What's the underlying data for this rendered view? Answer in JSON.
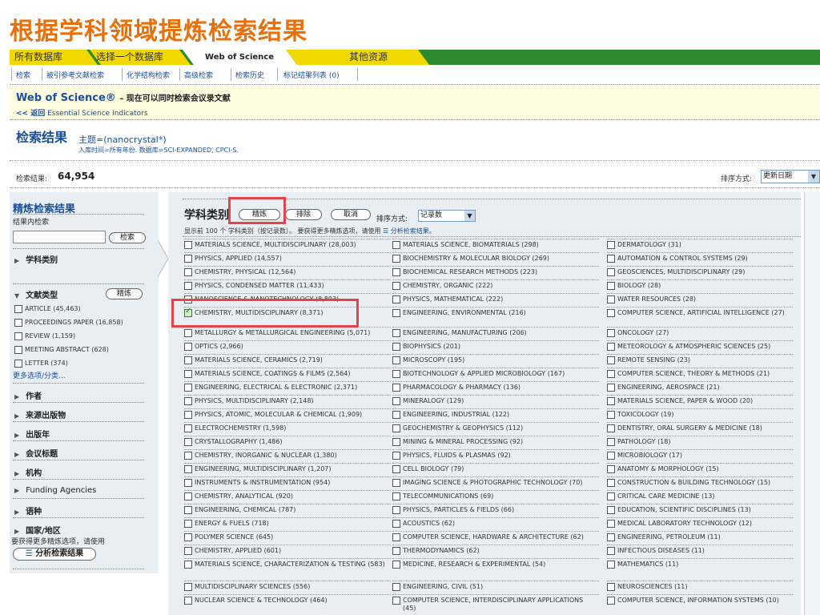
{
  "slide_title": "根据学科领域提炼检索结果",
  "tabs": {
    "all_db": "所有数据库",
    "choose_db": "选择一个数据库",
    "wos": "Web of Science",
    "other": "其他资源"
  },
  "subnav": [
    "检索",
    "被引参考文献检索",
    "化学结构检索",
    "高级检索",
    "检索历史",
    "标记结果列表 (0)"
  ],
  "wos_header": {
    "title": "Web of Science®",
    "subtitle": "– 现在可以同时检索会议录文献",
    "back": "<< 返回",
    "esi": "Essential Science Indicators"
  },
  "results": {
    "title": "检索结果",
    "topic": "主题=(nanocrystal*)",
    "meta": "入库时间=所有年份. 数据库=SCI-EXPANDED, CPCI-S.",
    "count_label": "检索结果:",
    "count": "64,954",
    "sort_label": "排序方式:",
    "sort_value": "更新日期"
  },
  "left_panel": {
    "title": "精炼检索结果",
    "hint": "结果内检索",
    "search_button": "检索",
    "subject": "学科类别",
    "doctype": "文献类型",
    "refine_button": "精炼",
    "doctypes": [
      "ARTICLE (45,463)",
      "PROCEEDINGS PAPER (16,858)",
      "REVIEW (1,159)",
      "MEETING ABSTRACT (628)",
      "LETTER (374)"
    ],
    "more": "更多选项/分类...",
    "sections": [
      "作者",
      "来源出版物",
      "出版年",
      "会议标题",
      "机构",
      "Funding Agencies",
      "语种",
      "国家/地区"
    ],
    "analyze_hint": "要获得更多精炼选项，请使用",
    "analyze_button": "分析检索结果"
  },
  "main_panel": {
    "title": "学科类别",
    "refine_button": "精炼",
    "exclude_button": "排除",
    "cancel_button": "取消",
    "sort_label": "排序方式:",
    "sort_value": "记录数",
    "showing_prefix": "显示前  100 个  学科类别（按记录数）。  要获得更多精炼选项，请使用",
    "showing_link": "分析检索结果。"
  },
  "categories": {
    "col1": [
      "MATERIALS SCIENCE, MULTIDISCIPLINARY (28,003)",
      "PHYSICS, APPLIED (14,557)",
      "CHEMISTRY, PHYSICAL (12,564)",
      "PHYSICS, CONDENSED MATTER (11,433)",
      "NANOSCIENCE & NANOTECHNOLOGY (8,893)",
      "CHEMISTRY, MULTIDISCIPLINARY (8,371)",
      "METALLURGY & METALLURGICAL ENGINEERING (5,071)",
      "OPTICS (2,966)",
      "MATERIALS SCIENCE, CERAMICS (2,719)",
      "MATERIALS SCIENCE, COATINGS & FILMS (2,564)",
      "ENGINEERING, ELECTRICAL & ELECTRONIC (2,371)",
      "PHYSICS, MULTIDISCIPLINARY (2,148)",
      "PHYSICS, ATOMIC, MOLECULAR & CHEMICAL (1,909)",
      "ELECTROCHEMISTRY (1,598)",
      "CRYSTALLOGRAPHY (1,486)",
      "CHEMISTRY, INORGANIC & NUCLEAR (1,380)",
      "ENGINEERING, MULTIDISCIPLINARY (1,207)",
      "INSTRUMENTS & INSTRUMENTATION (954)",
      "CHEMISTRY, ANALYTICAL (920)",
      "ENGINEERING, CHEMICAL (787)",
      "ENERGY & FUELS (718)",
      "POLYMER SCIENCE (645)",
      "CHEMISTRY, APPLIED (601)",
      "MATERIALS SCIENCE, CHARACTERIZATION & TESTING (583)",
      "MULTIDISCIPLINARY SCIENCES (556)",
      "NUCLEAR SCIENCE & TECHNOLOGY (464)"
    ],
    "col2": [
      "MATERIALS SCIENCE, BIOMATERIALS (298)",
      "BIOCHEMISTRY & MOLECULAR BIOLOGY (269)",
      "BIOCHEMICAL RESEARCH METHODS (223)",
      "CHEMISTRY, ORGANIC (222)",
      "PHYSICS, MATHEMATICAL (222)",
      "ENGINEERING, ENVIRONMENTAL (216)",
      "ENGINEERING, MANUFACTURING (206)",
      "BIOPHYSICS (201)",
      "MICROSCOPY (195)",
      "BIOTECHNOLOGY & APPLIED MICROBIOLOGY (167)",
      "PHARMACOLOGY & PHARMACY (136)",
      "MINERALOGY (129)",
      "ENGINEERING, INDUSTRIAL (122)",
      "GEOCHEMISTRY & GEOPHYSICS (112)",
      "MINING & MINERAL PROCESSING (92)",
      "PHYSICS, FLUIDS & PLASMAS (92)",
      "CELL BIOLOGY (79)",
      "IMAGING SCIENCE & PHOTOGRAPHIC TECHNOLOGY (70)",
      "TELECOMMUNICATIONS (69)",
      "PHYSICS, PARTICLES & FIELDS (66)",
      "ACOUSTICS (62)",
      "COMPUTER SCIENCE, HARDWARE & ARCHITECTURE (62)",
      "THERMODYNAMICS (62)",
      "MEDICINE, RESEARCH & EXPERIMENTAL (54)",
      "ENGINEERING, CIVIL (51)",
      "COMPUTER SCIENCE, INTERDISCIPLINARY APPLICATIONS (45)"
    ],
    "col3": [
      "DERMATOLOGY (31)",
      "AUTOMATION & CONTROL SYSTEMS (29)",
      "GEOSCIENCES, MULTIDISCIPLINARY (29)",
      "BIOLOGY (28)",
      "WATER RESOURCES (28)",
      "COMPUTER SCIENCE, ARTIFICIAL INTELLIGENCE (27)",
      "ONCOLOGY (27)",
      "METEOROLOGY & ATMOSPHERIC SCIENCES (25)",
      "REMOTE SENSING (23)",
      "COMPUTER SCIENCE, THEORY & METHODS (21)",
      "ENGINEERING, AEROSPACE (21)",
      "MATERIALS SCIENCE, PAPER & WOOD (20)",
      "TOXICOLOGY (19)",
      "DENTISTRY, ORAL SURGERY & MEDICINE (18)",
      "PATHOLOGY (18)",
      "MICROBIOLOGY (17)",
      "ANATOMY & MORPHOLOGY (15)",
      "CONSTRUCTION & BUILDING TECHNOLOGY (15)",
      "CRITICAL CARE MEDICINE (13)",
      "EDUCATION, SCIENTIFIC DISCIPLINES (13)",
      "MEDICAL LABORATORY TECHNOLOGY (12)",
      "ENGINEERING, PETROLEUM (11)",
      "INFECTIOUS DISEASES (11)",
      "MATHEMATICS (11)",
      "NEUROSCIENCES (11)",
      "COMPUTER SCIENCE, INFORMATION SYSTEMS (10)"
    ]
  },
  "colors": {
    "title_orange": "#e8700a",
    "nav_green": "#2d8a2d",
    "tab_yellow": "#f0d800",
    "link_blue": "#1a4f9c",
    "highlight_red": "#e8424a"
  }
}
